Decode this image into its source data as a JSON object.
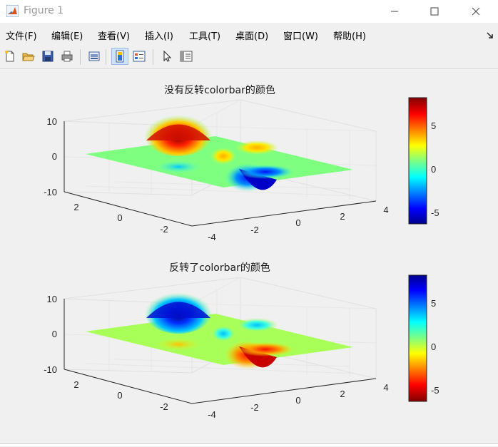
{
  "window": {
    "title": "Figure 1"
  },
  "menu": [
    {
      "label": "文件(F)"
    },
    {
      "label": "编辑(E)"
    },
    {
      "label": "查看(V)"
    },
    {
      "label": "插入(I)"
    },
    {
      "label": "工具(T)"
    },
    {
      "label": "桌面(D)"
    },
    {
      "label": "窗口(W)"
    },
    {
      "label": "帮助(H)"
    }
  ],
  "toolbar_icons": [
    "new-figure-icon",
    "open-file-icon",
    "save-icon",
    "print-icon",
    "link-plot-icon",
    "insert-colorbar-icon",
    "insert-legend-icon",
    "edit-plot-arrow-icon",
    "property-inspector-icon"
  ],
  "plots": [
    {
      "title": "没有反转colorbar的颜色",
      "colormap": "jet",
      "colorbar_ticks": [
        "5",
        "0",
        "-5"
      ],
      "z_ticks": [
        "10",
        "0",
        "-10"
      ],
      "y_ticks": [
        "2",
        "0",
        "-2"
      ],
      "x_ticks": [
        "-4",
        "-2",
        "0",
        "2",
        "4"
      ]
    },
    {
      "title": "反转了colorbar的颜色",
      "colormap": "jet (reversed)",
      "colorbar_ticks": [
        "5",
        "0",
        "-5"
      ],
      "z_ticks": [
        "10",
        "0",
        "-10"
      ],
      "y_ticks": [
        "2",
        "0",
        "-2"
      ],
      "x_ticks": [
        "-4",
        "-2",
        "0",
        "2",
        "4"
      ]
    }
  ]
}
